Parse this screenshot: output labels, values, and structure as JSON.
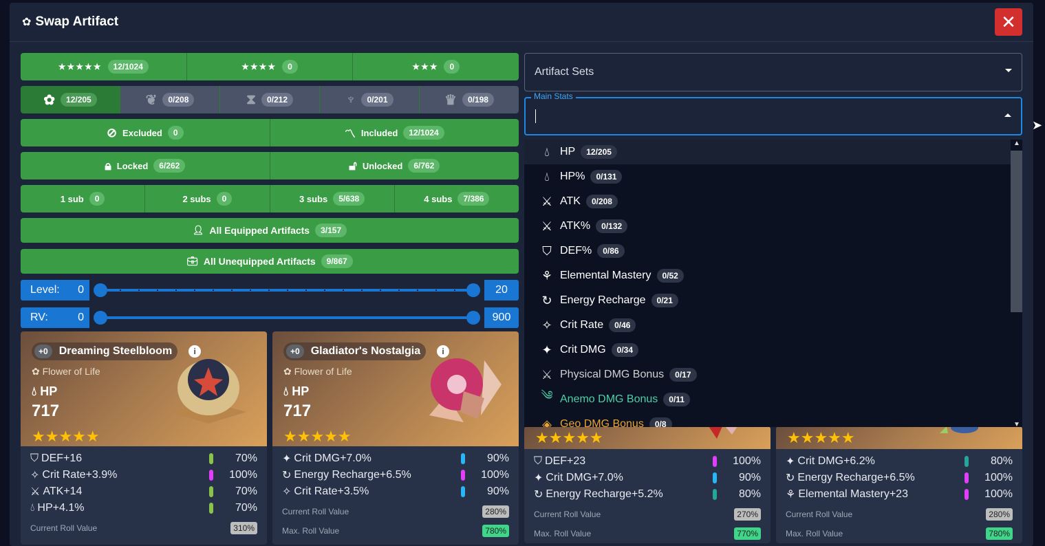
{
  "title": "Swap Artifact",
  "close_label": "✕",
  "rarity_filters": [
    {
      "label": "★★★★★",
      "count": "12/1024"
    },
    {
      "label": "★★★★",
      "count": "0"
    },
    {
      "label": "★★★",
      "count": "0"
    }
  ],
  "slot_filters": [
    {
      "icon": "flower-icon",
      "count": "12/205"
    },
    {
      "icon": "plume-icon",
      "count": "0/208"
    },
    {
      "icon": "sands-icon",
      "count": "0/212"
    },
    {
      "icon": "goblet-icon",
      "count": "0/201"
    },
    {
      "icon": "circlet-icon",
      "count": "0/198"
    }
  ],
  "exclusion": [
    {
      "label": "Excluded",
      "count": "0"
    },
    {
      "label": "Included",
      "count": "12/1024"
    }
  ],
  "lock": [
    {
      "label": "Locked",
      "count": "6/262"
    },
    {
      "label": "Unlocked",
      "count": "6/762"
    }
  ],
  "subs": [
    {
      "label": "1 sub",
      "count": "0"
    },
    {
      "label": "2 subs",
      "count": "0"
    },
    {
      "label": "3 subs",
      "count": "5/638"
    },
    {
      "label": "4 subs",
      "count": "7/386"
    }
  ],
  "equipped": {
    "label": "All Equipped Artifacts",
    "count": "3/157"
  },
  "unequipped": {
    "label": "All Unequipped Artifacts",
    "count": "9/867"
  },
  "level_slider": {
    "label": "Level:",
    "min": "0",
    "max": "20"
  },
  "rv_slider": {
    "label": "RV:",
    "min": "0",
    "max": "900"
  },
  "artifact_sets": {
    "placeholder": "Artifact Sets"
  },
  "main_stats": {
    "label": "Main Stats",
    "value": ""
  },
  "dropdown": [
    {
      "label": "HP",
      "count": "12/205",
      "icon": "hp-icon",
      "color": "#ffffff"
    },
    {
      "label": "HP%",
      "count": "0/131",
      "icon": "hp-icon",
      "color": "#ffffff"
    },
    {
      "label": "ATK",
      "count": "0/208",
      "icon": "atk-icon",
      "color": "#ffffff"
    },
    {
      "label": "ATK%",
      "count": "0/132",
      "icon": "atk-icon",
      "color": "#ffffff"
    },
    {
      "label": "DEF%",
      "count": "0/86",
      "icon": "def-icon",
      "color": "#ffffff"
    },
    {
      "label": "Elemental Mastery",
      "count": "0/52",
      "icon": "em-icon",
      "color": "#ffffff"
    },
    {
      "label": "Energy Recharge",
      "count": "0/21",
      "icon": "er-icon",
      "color": "#ffffff"
    },
    {
      "label": "Crit Rate",
      "count": "0/46",
      "icon": "crit-rate-icon",
      "color": "#ffffff"
    },
    {
      "label": "Crit DMG",
      "count": "0/34",
      "icon": "crit-dmg-icon",
      "color": "#ffffff"
    },
    {
      "label": "Physical DMG Bonus",
      "count": "0/17",
      "icon": "physical-icon",
      "color": "#d0d0d0"
    },
    {
      "label": "Anemo DMG Bonus",
      "count": "0/11",
      "icon": "anemo-icon",
      "color": "#4ecfa5"
    },
    {
      "label": "Geo DMG Bonus",
      "count": "0/8",
      "icon": "geo-icon",
      "color": "#e8a332"
    }
  ],
  "cards": [
    {
      "level": "+0",
      "name": "Dreaming Steelbloom",
      "slot": "Flower of Life",
      "main_stat": "HP",
      "main_value": "717",
      "stars": "★★★★★",
      "subs": [
        {
          "label": "DEF+16",
          "pct": "70%",
          "color": "#8bc34a",
          "icon": "def-icon"
        },
        {
          "label": "Crit Rate+3.9%",
          "pct": "100%",
          "color": "#e040fb",
          "icon": "crit-rate-icon"
        },
        {
          "label": "ATK+14",
          "pct": "70%",
          "color": "#8bc34a",
          "icon": "atk-icon"
        },
        {
          "label": "HP+4.1%",
          "pct": "70%",
          "color": "#8bc34a",
          "icon": "hp-icon"
        }
      ],
      "rv_label": "Current Roll Value",
      "rv": "310%"
    },
    {
      "level": "+0",
      "name": "Gladiator's Nostalgia",
      "slot": "Flower of Life",
      "main_stat": "HP",
      "main_value": "717",
      "stars": "★★★★★",
      "subs": [
        {
          "label": "Crit DMG+7.0%",
          "pct": "90%",
          "color": "#29b6f6",
          "icon": "crit-dmg-icon"
        },
        {
          "label": "Energy Recharge+6.5%",
          "pct": "100%",
          "color": "#e040fb",
          "icon": "er-icon"
        },
        {
          "label": "Crit Rate+3.5%",
          "pct": "90%",
          "color": "#29b6f6",
          "icon": "crit-rate-icon"
        }
      ],
      "rv_label": "Current Roll Value",
      "rv": "280%",
      "max_rv_label": "Max. Roll Value",
      "max_rv": "780%"
    },
    {
      "stars": "★★★★★",
      "subs": [
        {
          "label": "DEF+23",
          "pct": "100%",
          "color": "#e040fb",
          "icon": "def-icon"
        },
        {
          "label": "Crit DMG+7.0%",
          "pct": "90%",
          "color": "#29b6f6",
          "icon": "crit-dmg-icon"
        },
        {
          "label": "Energy Recharge+5.2%",
          "pct": "80%",
          "color": "#26a69a",
          "icon": "er-icon"
        }
      ],
      "rv_label": "Current Roll Value",
      "rv": "270%",
      "max_rv_label": "Max. Roll Value",
      "max_rv": "770%"
    },
    {
      "stars": "★★★★★",
      "subs": [
        {
          "label": "Crit DMG+6.2%",
          "pct": "80%",
          "color": "#26a69a",
          "icon": "crit-dmg-icon"
        },
        {
          "label": "Energy Recharge+6.5%",
          "pct": "100%",
          "color": "#e040fb",
          "icon": "er-icon"
        },
        {
          "label": "Elemental Mastery+23",
          "pct": "100%",
          "color": "#e040fb",
          "icon": "em-icon"
        }
      ],
      "rv_label": "Current Roll Value",
      "rv": "280%",
      "max_rv_label": "Max. Roll Value",
      "max_rv": "780%"
    }
  ]
}
